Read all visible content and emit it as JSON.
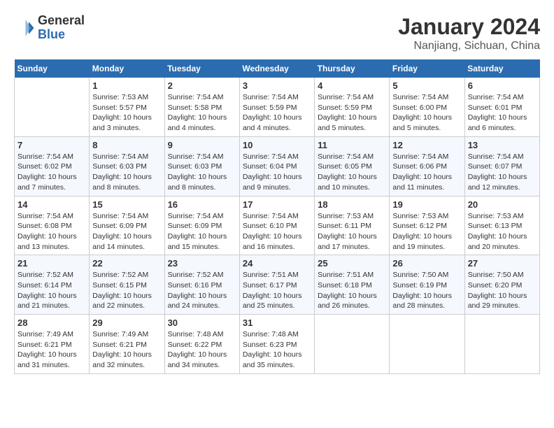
{
  "header": {
    "logo_general": "General",
    "logo_blue": "Blue",
    "month_title": "January 2024",
    "location": "Nanjiang, Sichuan, China"
  },
  "weekdays": [
    "Sunday",
    "Monday",
    "Tuesday",
    "Wednesday",
    "Thursday",
    "Friday",
    "Saturday"
  ],
  "weeks": [
    [
      {
        "day": "",
        "sunrise": "",
        "sunset": "",
        "daylight": ""
      },
      {
        "day": "1",
        "sunrise": "Sunrise: 7:53 AM",
        "sunset": "Sunset: 5:57 PM",
        "daylight": "Daylight: 10 hours and 3 minutes."
      },
      {
        "day": "2",
        "sunrise": "Sunrise: 7:54 AM",
        "sunset": "Sunset: 5:58 PM",
        "daylight": "Daylight: 10 hours and 4 minutes."
      },
      {
        "day": "3",
        "sunrise": "Sunrise: 7:54 AM",
        "sunset": "Sunset: 5:59 PM",
        "daylight": "Daylight: 10 hours and 4 minutes."
      },
      {
        "day": "4",
        "sunrise": "Sunrise: 7:54 AM",
        "sunset": "Sunset: 5:59 PM",
        "daylight": "Daylight: 10 hours and 5 minutes."
      },
      {
        "day": "5",
        "sunrise": "Sunrise: 7:54 AM",
        "sunset": "Sunset: 6:00 PM",
        "daylight": "Daylight: 10 hours and 5 minutes."
      },
      {
        "day": "6",
        "sunrise": "Sunrise: 7:54 AM",
        "sunset": "Sunset: 6:01 PM",
        "daylight": "Daylight: 10 hours and 6 minutes."
      }
    ],
    [
      {
        "day": "7",
        "sunrise": "Sunrise: 7:54 AM",
        "sunset": "Sunset: 6:02 PM",
        "daylight": "Daylight: 10 hours and 7 minutes."
      },
      {
        "day": "8",
        "sunrise": "Sunrise: 7:54 AM",
        "sunset": "Sunset: 6:03 PM",
        "daylight": "Daylight: 10 hours and 8 minutes."
      },
      {
        "day": "9",
        "sunrise": "Sunrise: 7:54 AM",
        "sunset": "Sunset: 6:03 PM",
        "daylight": "Daylight: 10 hours and 8 minutes."
      },
      {
        "day": "10",
        "sunrise": "Sunrise: 7:54 AM",
        "sunset": "Sunset: 6:04 PM",
        "daylight": "Daylight: 10 hours and 9 minutes."
      },
      {
        "day": "11",
        "sunrise": "Sunrise: 7:54 AM",
        "sunset": "Sunset: 6:05 PM",
        "daylight": "Daylight: 10 hours and 10 minutes."
      },
      {
        "day": "12",
        "sunrise": "Sunrise: 7:54 AM",
        "sunset": "Sunset: 6:06 PM",
        "daylight": "Daylight: 10 hours and 11 minutes."
      },
      {
        "day": "13",
        "sunrise": "Sunrise: 7:54 AM",
        "sunset": "Sunset: 6:07 PM",
        "daylight": "Daylight: 10 hours and 12 minutes."
      }
    ],
    [
      {
        "day": "14",
        "sunrise": "Sunrise: 7:54 AM",
        "sunset": "Sunset: 6:08 PM",
        "daylight": "Daylight: 10 hours and 13 minutes."
      },
      {
        "day": "15",
        "sunrise": "Sunrise: 7:54 AM",
        "sunset": "Sunset: 6:09 PM",
        "daylight": "Daylight: 10 hours and 14 minutes."
      },
      {
        "day": "16",
        "sunrise": "Sunrise: 7:54 AM",
        "sunset": "Sunset: 6:09 PM",
        "daylight": "Daylight: 10 hours and 15 minutes."
      },
      {
        "day": "17",
        "sunrise": "Sunrise: 7:54 AM",
        "sunset": "Sunset: 6:10 PM",
        "daylight": "Daylight: 10 hours and 16 minutes."
      },
      {
        "day": "18",
        "sunrise": "Sunrise: 7:53 AM",
        "sunset": "Sunset: 6:11 PM",
        "daylight": "Daylight: 10 hours and 17 minutes."
      },
      {
        "day": "19",
        "sunrise": "Sunrise: 7:53 AM",
        "sunset": "Sunset: 6:12 PM",
        "daylight": "Daylight: 10 hours and 19 minutes."
      },
      {
        "day": "20",
        "sunrise": "Sunrise: 7:53 AM",
        "sunset": "Sunset: 6:13 PM",
        "daylight": "Daylight: 10 hours and 20 minutes."
      }
    ],
    [
      {
        "day": "21",
        "sunrise": "Sunrise: 7:52 AM",
        "sunset": "Sunset: 6:14 PM",
        "daylight": "Daylight: 10 hours and 21 minutes."
      },
      {
        "day": "22",
        "sunrise": "Sunrise: 7:52 AM",
        "sunset": "Sunset: 6:15 PM",
        "daylight": "Daylight: 10 hours and 22 minutes."
      },
      {
        "day": "23",
        "sunrise": "Sunrise: 7:52 AM",
        "sunset": "Sunset: 6:16 PM",
        "daylight": "Daylight: 10 hours and 24 minutes."
      },
      {
        "day": "24",
        "sunrise": "Sunrise: 7:51 AM",
        "sunset": "Sunset: 6:17 PM",
        "daylight": "Daylight: 10 hours and 25 minutes."
      },
      {
        "day": "25",
        "sunrise": "Sunrise: 7:51 AM",
        "sunset": "Sunset: 6:18 PM",
        "daylight": "Daylight: 10 hours and 26 minutes."
      },
      {
        "day": "26",
        "sunrise": "Sunrise: 7:50 AM",
        "sunset": "Sunset: 6:19 PM",
        "daylight": "Daylight: 10 hours and 28 minutes."
      },
      {
        "day": "27",
        "sunrise": "Sunrise: 7:50 AM",
        "sunset": "Sunset: 6:20 PM",
        "daylight": "Daylight: 10 hours and 29 minutes."
      }
    ],
    [
      {
        "day": "28",
        "sunrise": "Sunrise: 7:49 AM",
        "sunset": "Sunset: 6:21 PM",
        "daylight": "Daylight: 10 hours and 31 minutes."
      },
      {
        "day": "29",
        "sunrise": "Sunrise: 7:49 AM",
        "sunset": "Sunset: 6:21 PM",
        "daylight": "Daylight: 10 hours and 32 minutes."
      },
      {
        "day": "30",
        "sunrise": "Sunrise: 7:48 AM",
        "sunset": "Sunset: 6:22 PM",
        "daylight": "Daylight: 10 hours and 34 minutes."
      },
      {
        "day": "31",
        "sunrise": "Sunrise: 7:48 AM",
        "sunset": "Sunset: 6:23 PM",
        "daylight": "Daylight: 10 hours and 35 minutes."
      },
      {
        "day": "",
        "sunrise": "",
        "sunset": "",
        "daylight": ""
      },
      {
        "day": "",
        "sunrise": "",
        "sunset": "",
        "daylight": ""
      },
      {
        "day": "",
        "sunrise": "",
        "sunset": "",
        "daylight": ""
      }
    ]
  ]
}
